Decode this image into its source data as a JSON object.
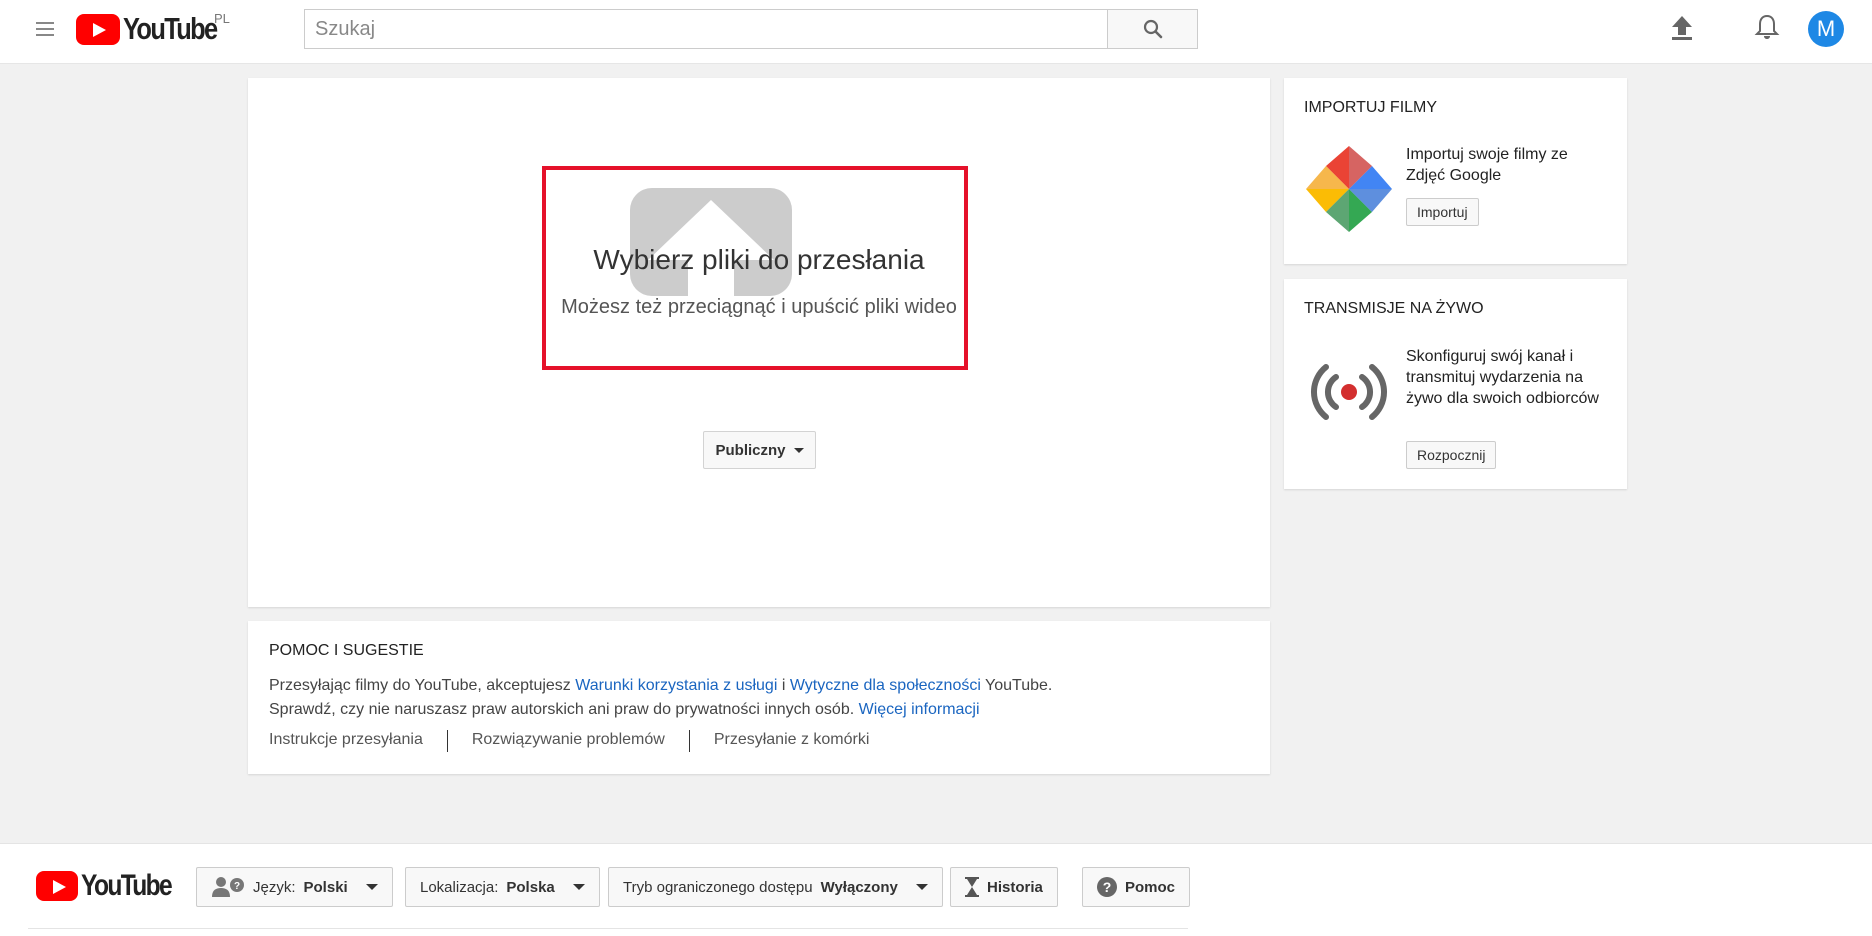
{
  "header": {
    "logo_text": "YouTube",
    "region": "PL",
    "search_placeholder": "Szukaj",
    "avatar_letter": "M",
    "icons": [
      "menu-icon",
      "search-icon",
      "upload-icon",
      "bell-icon"
    ]
  },
  "upload": {
    "title": "Wybierz pliki do przesłania",
    "drag_hint": "Możesz też przeciągnąć i upuścić pliki wideo",
    "privacy_label": "Publiczny",
    "highlight_color": "#e5112a"
  },
  "help": {
    "title": "POMOC I SUGESTIE",
    "line1_prefix": "Przesyłając filmy do YouTube, akceptujesz ",
    "terms_link": "Warunki korzystania z usługi",
    "line1_and": " i ",
    "guidelines_link": "Wytyczne dla społeczności",
    "line1_suffix": " YouTube.",
    "line2_text": "Sprawdź, czy nie naruszasz praw autorskich ani praw do prywatności innych osób. ",
    "more_info_link": "Więcej informacji",
    "links": [
      "Instrukcje przesyłania",
      "Rozwiązywanie problemów",
      "Przesyłanie z komórki"
    ]
  },
  "import": {
    "title": "IMPORTUJ FILMY",
    "description": "Importuj swoje filmy ze Zdjęć Google",
    "button": "Importuj"
  },
  "live": {
    "title": "TRANSMISJE NA ŻYWO",
    "description": "Skonfiguruj swój kanał i transmituj wydarzenia na żywo dla swoich odbiorców",
    "button": "Rozpocznij"
  },
  "footer": {
    "logo_text": "YouTube",
    "language_label": "Język:",
    "language_value": "Polski",
    "location_label": "Lokalizacja:",
    "location_value": "Polska",
    "restricted_label": "Tryb ograniczonego dostępu",
    "restricted_value": "Wyłączony",
    "history": "Historia",
    "help": "Pomoc"
  },
  "colors": {
    "brand_red": "#ff0000",
    "link_blue": "#1a65c0",
    "avatar_blue": "#1e88e5"
  }
}
